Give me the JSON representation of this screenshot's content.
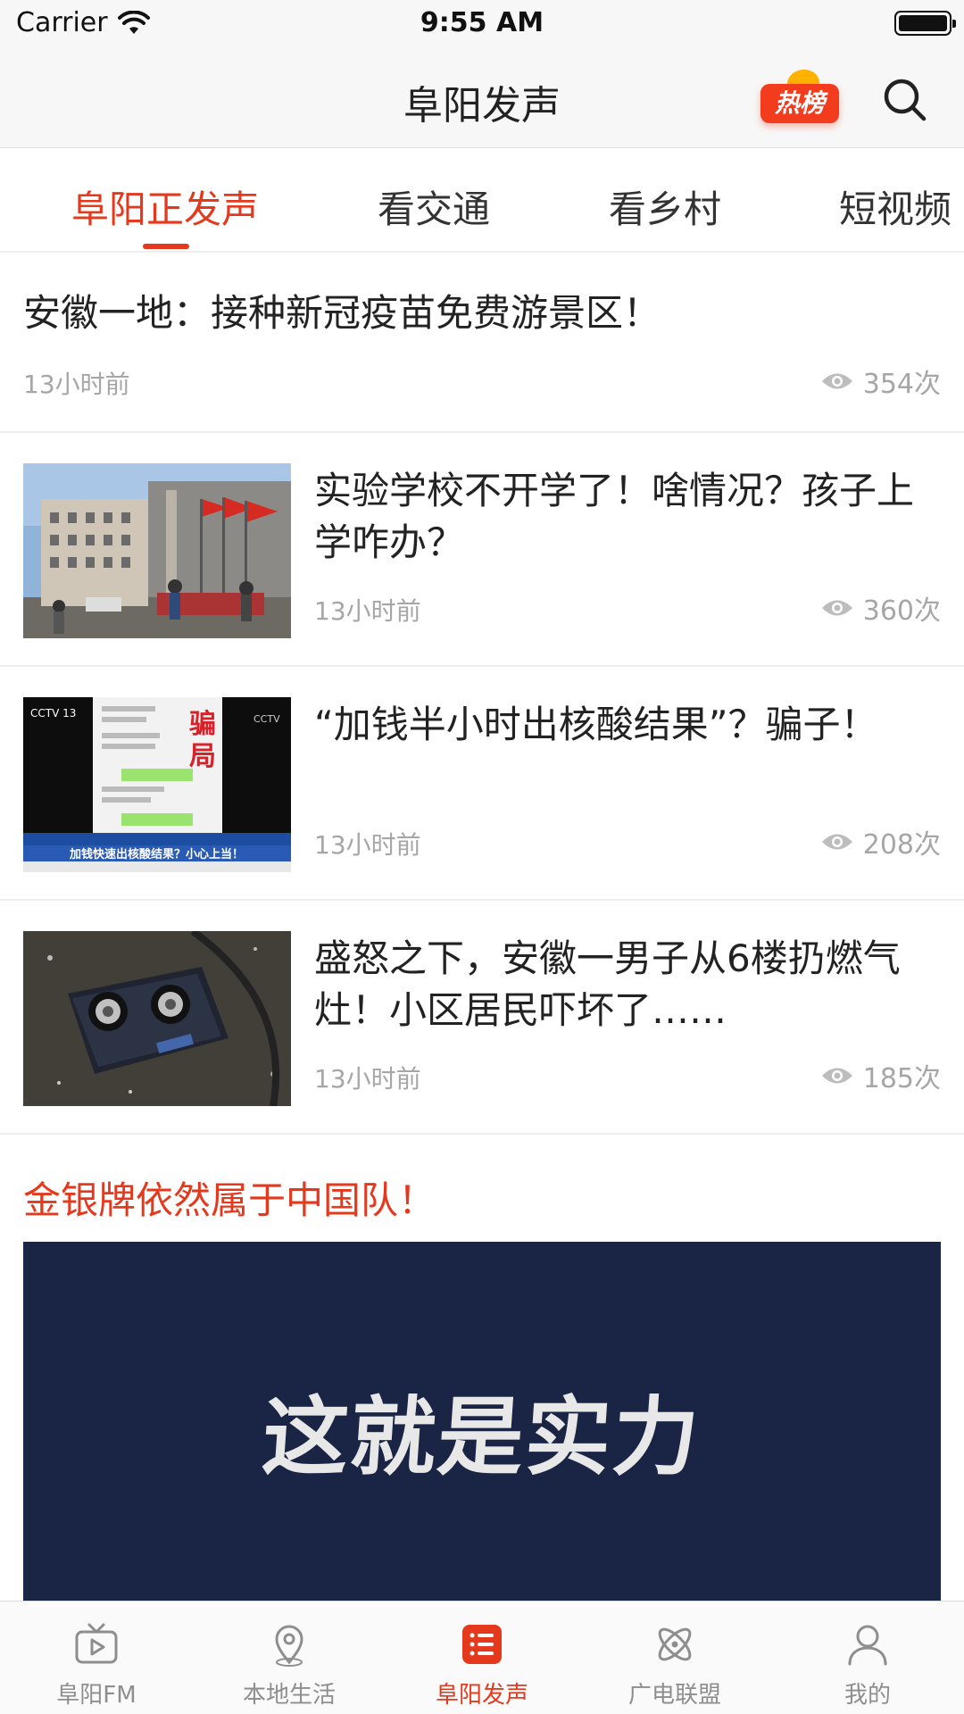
{
  "status_bar": {
    "carrier": "Carrier",
    "time": "9:55 AM"
  },
  "nav": {
    "title": "阜阳发声",
    "hot_badge": "热榜"
  },
  "tabs": [
    {
      "label": "阜阳正发声",
      "active": true
    },
    {
      "label": "看交通",
      "active": false
    },
    {
      "label": "看乡村",
      "active": false
    },
    {
      "label": "短视频",
      "active": false
    }
  ],
  "feed": [
    {
      "title": "安徽一地：接种新冠疫苗免费游景区！",
      "time": "13小时前",
      "views": "354次",
      "has_image": false
    },
    {
      "title": "实验学校不开学了！啥情况？孩子上学咋办？",
      "time": "13小时前",
      "views": "360次",
      "has_image": true,
      "thumb": "school-flags"
    },
    {
      "title": "“加钱半小时出核酸结果”？骗子！",
      "time": "13小时前",
      "views": "208次",
      "has_image": true,
      "thumb": "cctv-news-scam",
      "thumb_text": {
        "badge": "骗局",
        "caption": "加钱快速出核酸结果？小心上当！"
      }
    },
    {
      "title": "盛怒之下，安徽一男子从6楼扔燃气灶！小区居民吓坏了……",
      "time": "13小时前",
      "views": "185次",
      "has_image": true,
      "thumb": "broken-stove"
    }
  ],
  "special": {
    "title": "金银牌依然属于中国队！",
    "banner_text": "这就是实力"
  },
  "tab_bar": [
    {
      "label": "阜阳FM",
      "icon": "tv-play-icon",
      "active": false
    },
    {
      "label": "本地生活",
      "icon": "location-pin-icon",
      "active": false
    },
    {
      "label": "阜阳发声",
      "icon": "list-icon",
      "active": true
    },
    {
      "label": "广电联盟",
      "icon": "atom-icon",
      "active": false
    },
    {
      "label": "我的",
      "icon": "user-icon",
      "active": false
    }
  ],
  "colors": {
    "accent": "#e5391e",
    "muted": "#a6a6a6",
    "banner_bg": "#1a2545"
  }
}
